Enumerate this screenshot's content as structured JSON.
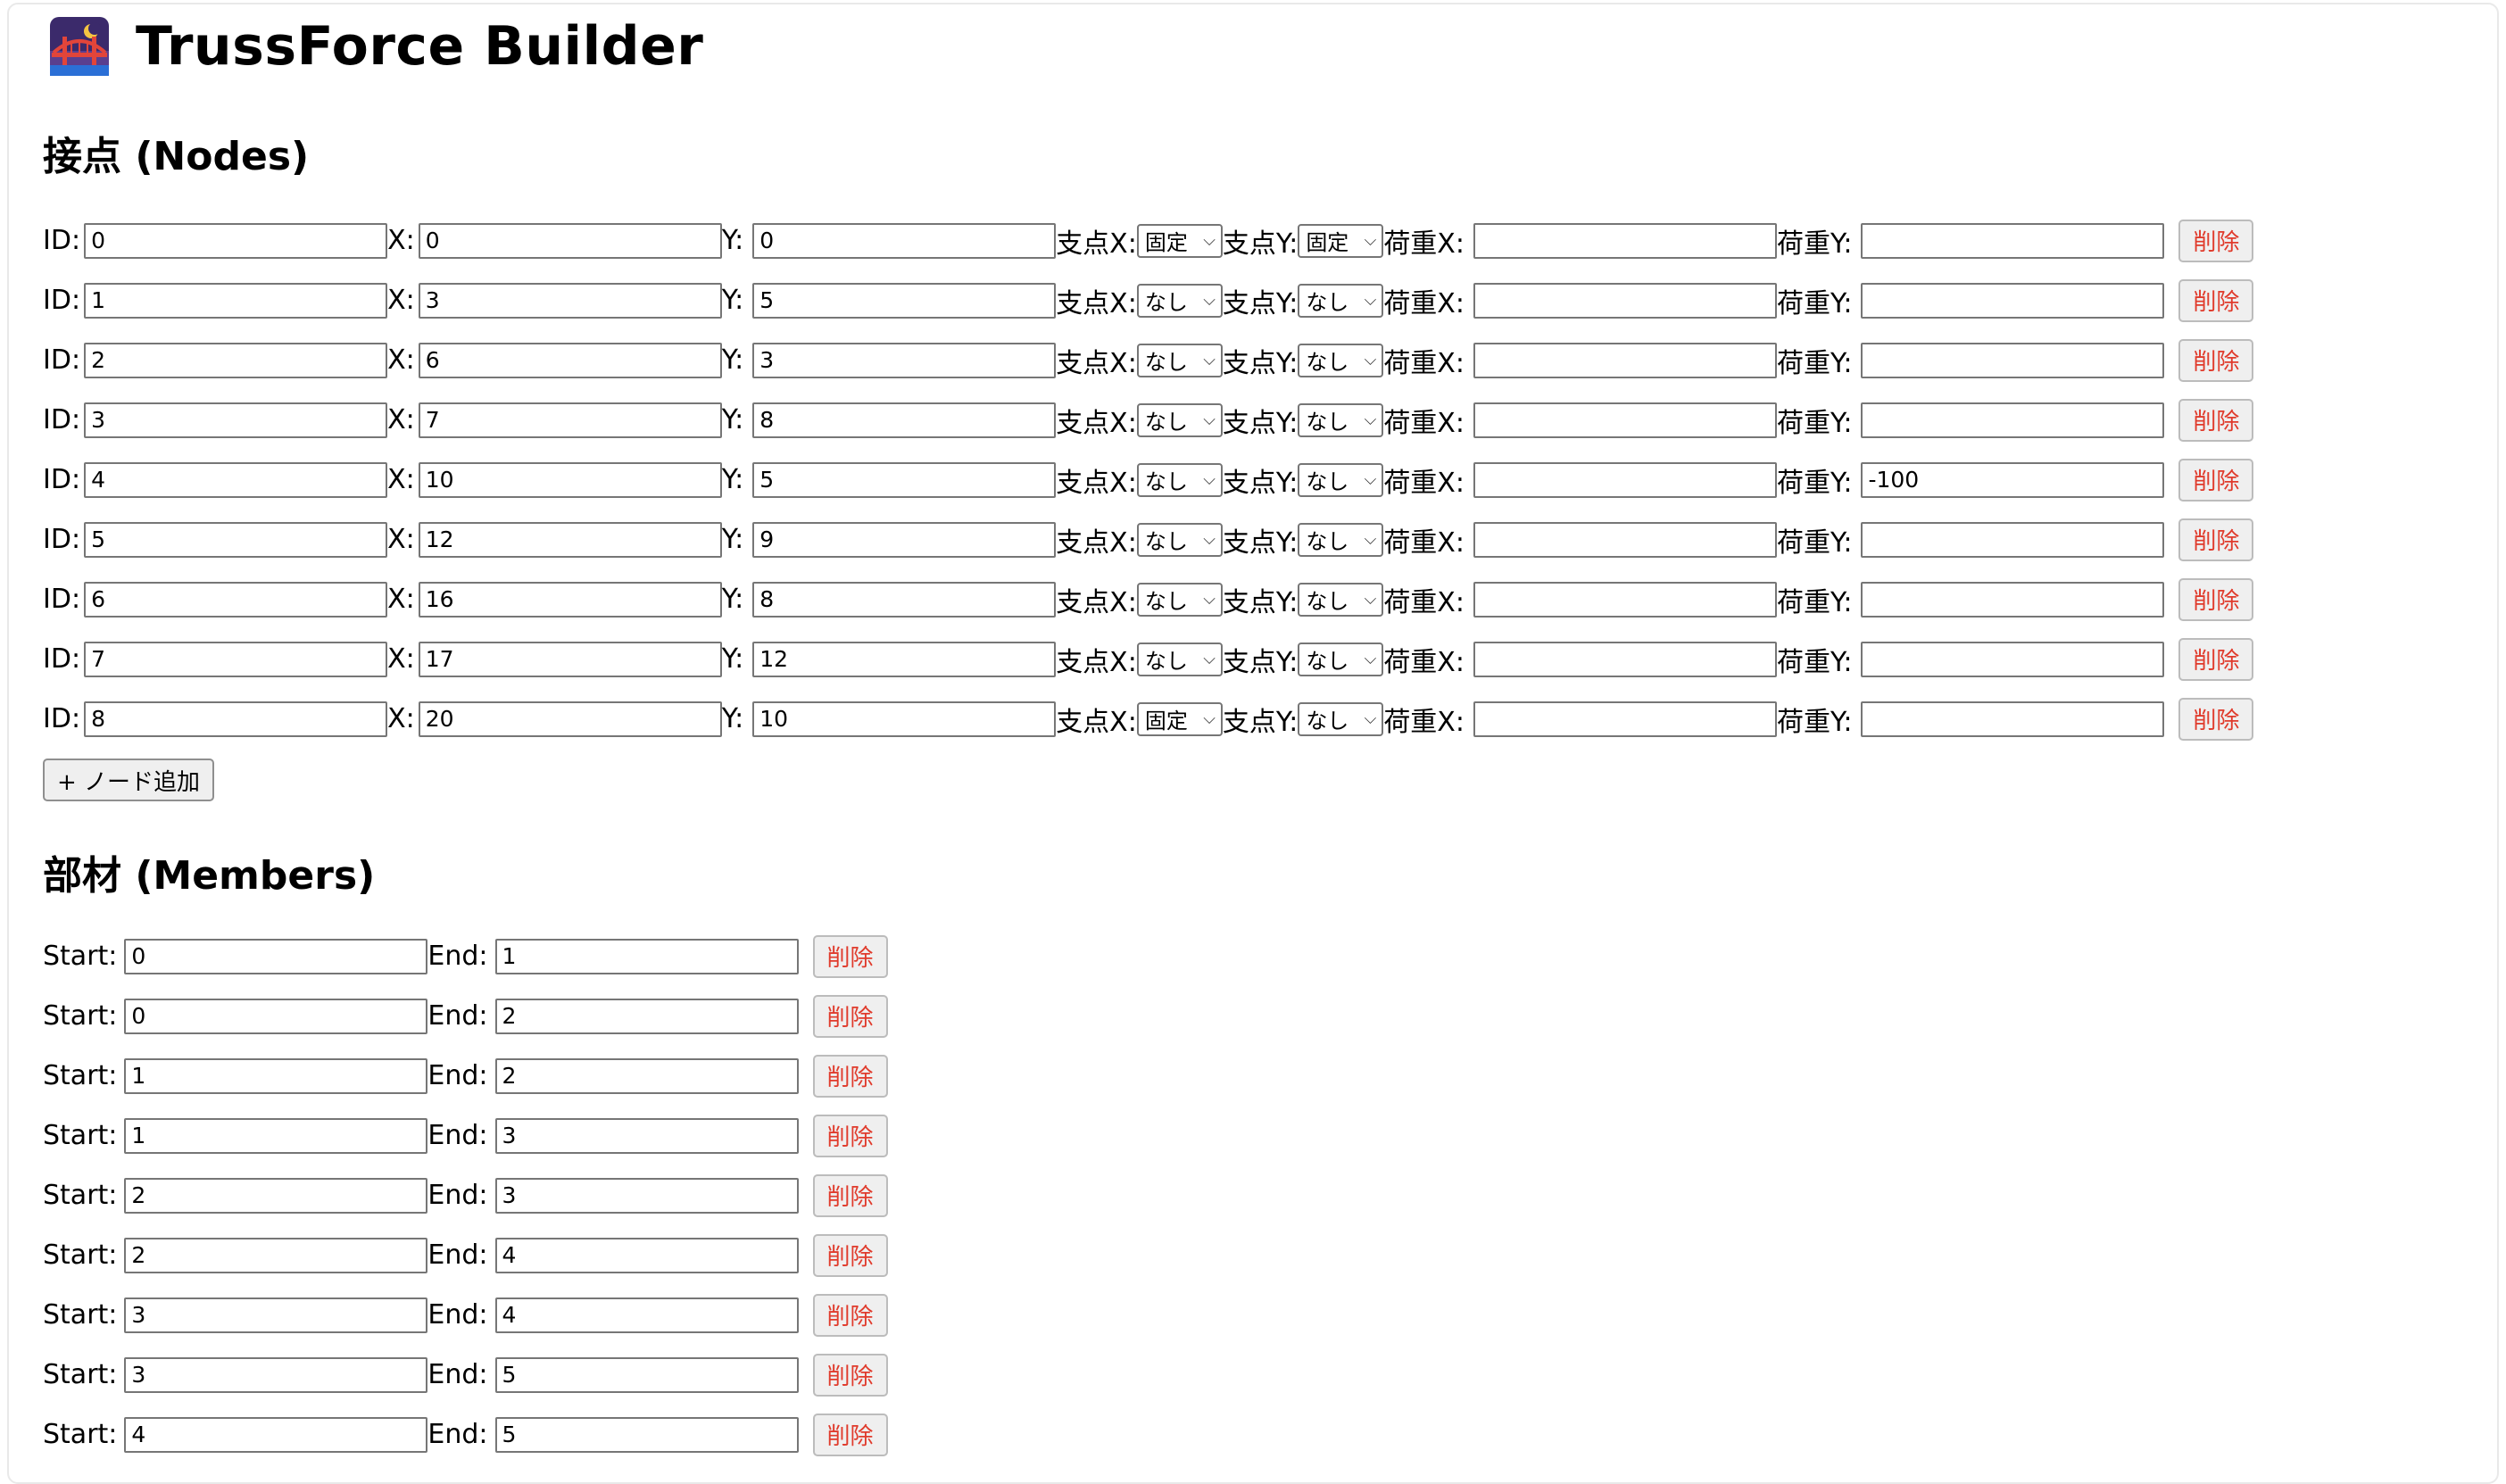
{
  "app": {
    "title": "TrussForce Builder",
    "logo_icon": "bridge-at-night-icon"
  },
  "nodes_section": {
    "title": "接点 (Nodes)",
    "labels": {
      "id": "ID:",
      "x": "X:",
      "y": "Y:",
      "support_x": "支点X:",
      "support_y": "支点Y:",
      "load_x": "荷重X:",
      "load_y": "荷重Y:"
    },
    "delete_label": "削除",
    "add_label": "+ ノード追加",
    "rows": [
      {
        "id": "0",
        "x": "0",
        "y": "0",
        "support_x": "固定",
        "support_y": "固定",
        "load_x": "",
        "load_y": ""
      },
      {
        "id": "1",
        "x": "3",
        "y": "5",
        "support_x": "なし",
        "support_y": "なし",
        "load_x": "",
        "load_y": ""
      },
      {
        "id": "2",
        "x": "6",
        "y": "3",
        "support_x": "なし",
        "support_y": "なし",
        "load_x": "",
        "load_y": ""
      },
      {
        "id": "3",
        "x": "7",
        "y": "8",
        "support_x": "なし",
        "support_y": "なし",
        "load_x": "",
        "load_y": ""
      },
      {
        "id": "4",
        "x": "10",
        "y": "5",
        "support_x": "なし",
        "support_y": "なし",
        "load_x": "",
        "load_y": "-100"
      },
      {
        "id": "5",
        "x": "12",
        "y": "9",
        "support_x": "なし",
        "support_y": "なし",
        "load_x": "",
        "load_y": ""
      },
      {
        "id": "6",
        "x": "16",
        "y": "8",
        "support_x": "なし",
        "support_y": "なし",
        "load_x": "",
        "load_y": ""
      },
      {
        "id": "7",
        "x": "17",
        "y": "12",
        "support_x": "なし",
        "support_y": "なし",
        "load_x": "",
        "load_y": ""
      },
      {
        "id": "8",
        "x": "20",
        "y": "10",
        "support_x": "固定",
        "support_y": "なし",
        "load_x": "",
        "load_y": ""
      }
    ]
  },
  "members_section": {
    "title": "部材 (Members)",
    "labels": {
      "start": "Start:",
      "end": "End:"
    },
    "delete_label": "削除",
    "rows": [
      {
        "start": "0",
        "end": "1"
      },
      {
        "start": "0",
        "end": "2"
      },
      {
        "start": "1",
        "end": "2"
      },
      {
        "start": "1",
        "end": "3"
      },
      {
        "start": "2",
        "end": "3"
      },
      {
        "start": "2",
        "end": "4"
      },
      {
        "start": "3",
        "end": "4"
      },
      {
        "start": "3",
        "end": "5"
      },
      {
        "start": "4",
        "end": "5"
      }
    ]
  }
}
